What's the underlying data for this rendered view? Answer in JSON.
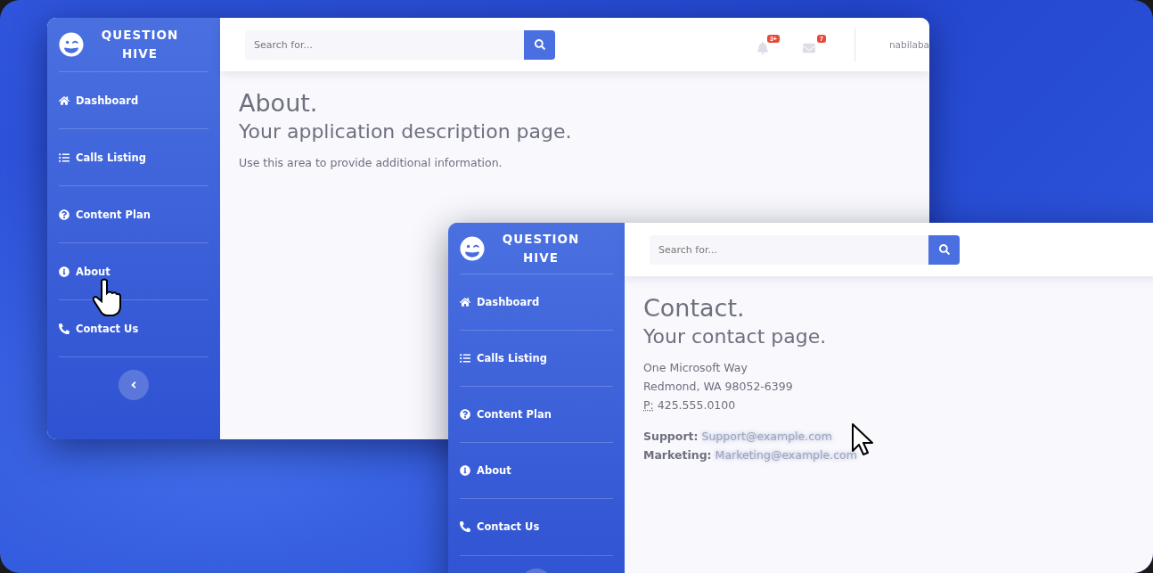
{
  "windows": [
    {
      "brand": "QUESTION HIVE",
      "search": {
        "placeholder": "Search for..."
      },
      "alerts": [
        {
          "kind": "bell",
          "count": "3+"
        },
        {
          "kind": "mail",
          "count": "7"
        }
      ],
      "user": "nabilaba",
      "nav": [
        {
          "label": "Dashboard"
        },
        {
          "label": "Calls Listing"
        },
        {
          "label": "Content Plan"
        },
        {
          "label": "About"
        },
        {
          "label": "Contact Us"
        }
      ],
      "content": {
        "title": "About.",
        "subtitle": "Your application description page.",
        "paragraphs": [
          "Use this area to provide additional information."
        ]
      }
    },
    {
      "brand": "QUESTION HIVE",
      "search": {
        "placeholder": "Search for..."
      },
      "nav": [
        {
          "label": "Dashboard"
        },
        {
          "label": "Calls Listing"
        },
        {
          "label": "Content Plan"
        },
        {
          "label": "About"
        },
        {
          "label": "Contact Us"
        }
      ],
      "content": {
        "title": "Contact.",
        "subtitle": "Your contact page.",
        "address": [
          "One Microsoft Way",
          "Redmond, WA 98052-6399"
        ],
        "phone": {
          "abbr": "P:",
          "number": "425.555.0100"
        },
        "contacts": [
          {
            "label": "Support:",
            "email": "Support@example.com"
          },
          {
            "label": "Marketing:",
            "email": "Marketing@example.com"
          }
        ]
      }
    }
  ]
}
